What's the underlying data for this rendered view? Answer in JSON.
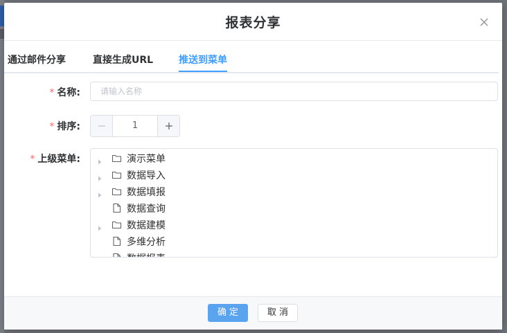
{
  "dialog": {
    "title": "报表分享"
  },
  "tabs": [
    {
      "label": "通过邮件分享",
      "active": false
    },
    {
      "label": "直接生成URL",
      "active": false
    },
    {
      "label": "推送到菜单",
      "active": true
    }
  ],
  "form": {
    "required_mark": "*",
    "name_label": "名称:",
    "name_value": "",
    "name_placeholder": "请输入名称",
    "order_label": "排序:",
    "order_value": "1",
    "parent_label": "上级菜单:"
  },
  "tree": {
    "nodes": [
      {
        "label": "演示菜单",
        "type": "folder",
        "expandable": true
      },
      {
        "label": "数据导入",
        "type": "folder",
        "expandable": true
      },
      {
        "label": "数据填报",
        "type": "folder",
        "expandable": true
      },
      {
        "label": "数据查询",
        "type": "file",
        "expandable": false
      },
      {
        "label": "数据建模",
        "type": "folder",
        "expandable": true
      },
      {
        "label": "多维分析",
        "type": "file",
        "expandable": false
      },
      {
        "label": "数据报表",
        "type": "file",
        "expandable": false
      }
    ]
  },
  "footer": {
    "ok_label": "确定",
    "cancel_label": "取消"
  },
  "colors": {
    "accent": "#409eff",
    "required": "#f56c6c",
    "primary_button": "#5aa3ef"
  }
}
